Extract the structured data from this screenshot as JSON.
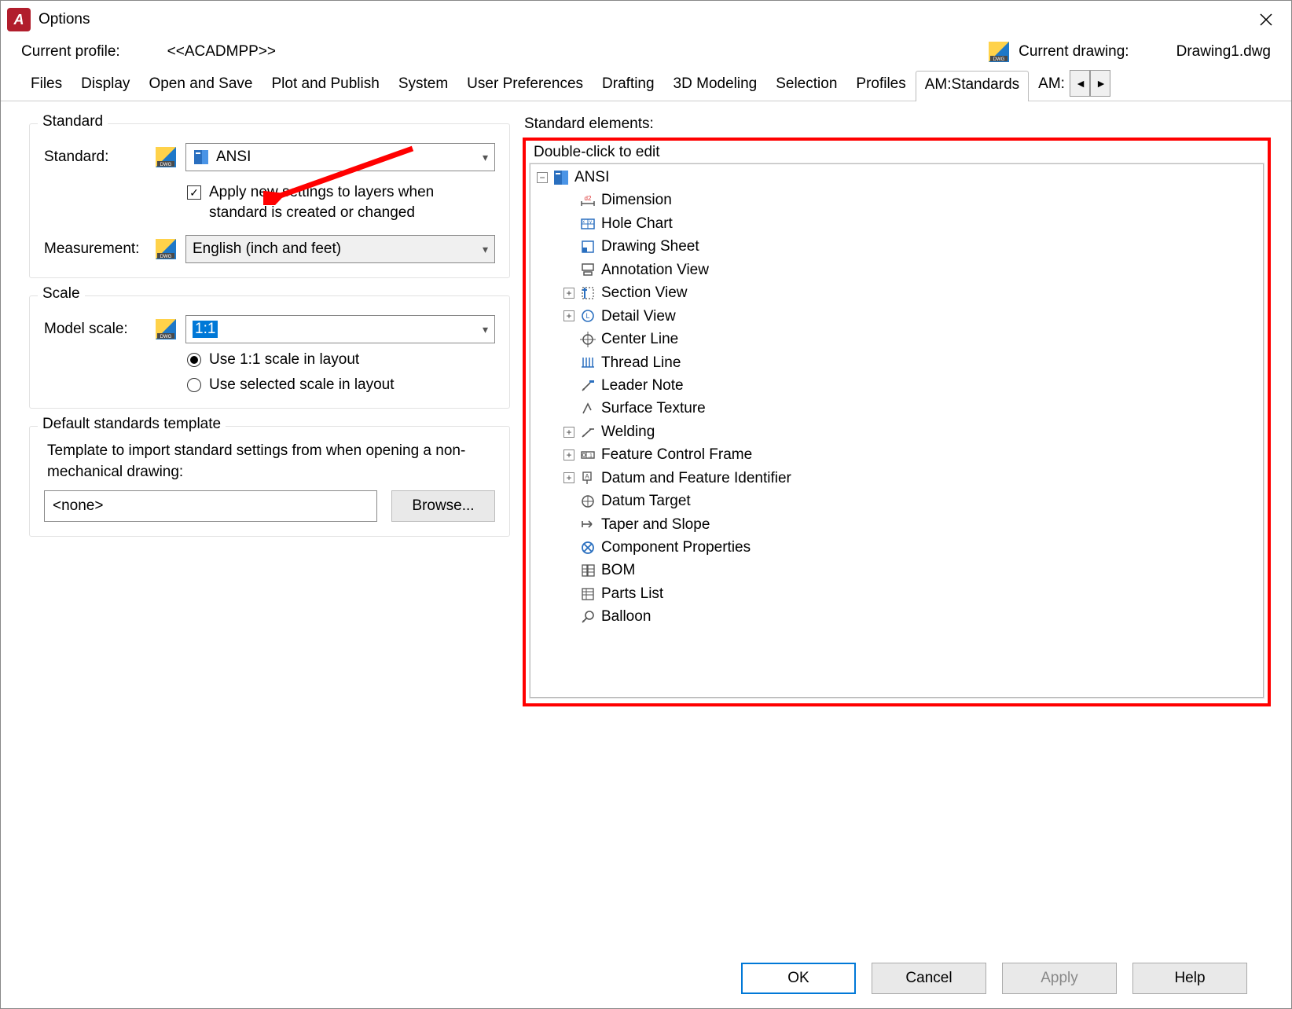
{
  "window": {
    "title": "Options"
  },
  "profile": {
    "label": "Current profile:",
    "value": "<<ACADMPP>>",
    "drawing_label": "Current drawing:",
    "drawing_value": "Drawing1.dwg"
  },
  "tabs": {
    "items": [
      "Files",
      "Display",
      "Open and Save",
      "Plot and Publish",
      "System",
      "User Preferences",
      "Drafting",
      "3D Modeling",
      "Selection",
      "Profiles",
      "AM:Standards",
      "AM:"
    ],
    "active_index": 10,
    "scroll_prev": "◄",
    "scroll_next": "►"
  },
  "standard_group": {
    "legend": "Standard",
    "standard_label": "Standard:",
    "standard_value": "ANSI",
    "apply_checkbox_checked": true,
    "apply_text": "Apply new settings to layers when standard is created or changed",
    "measurement_label": "Measurement:",
    "measurement_value": "English (inch and feet)"
  },
  "scale_group": {
    "legend": "Scale",
    "model_scale_label": "Model scale:",
    "model_scale_value": "1:1",
    "radio1": "Use 1:1 scale in layout",
    "radio2": "Use selected scale in layout",
    "selected_radio": 0
  },
  "template_group": {
    "legend": "Default standards template",
    "desc": "Template to import standard settings from when opening a non-mechanical drawing:",
    "value": "<none>",
    "browse": "Browse..."
  },
  "elements_panel": {
    "title": "Standard elements:",
    "hint": "Double-click to edit",
    "root": "ANSI",
    "items": [
      {
        "label": "Dimension",
        "icon": "dimension-icon"
      },
      {
        "label": "Hole Chart",
        "icon": "holechart-icon"
      },
      {
        "label": "Drawing Sheet",
        "icon": "drawingsheet-icon"
      },
      {
        "label": "Annotation View",
        "icon": "annotationview-icon"
      },
      {
        "label": "Section View",
        "icon": "sectionview-icon",
        "expandable": true
      },
      {
        "label": "Detail View",
        "icon": "detailview-icon",
        "expandable": true
      },
      {
        "label": "Center Line",
        "icon": "centerline-icon"
      },
      {
        "label": "Thread Line",
        "icon": "threadline-icon"
      },
      {
        "label": "Leader Note",
        "icon": "leadernote-icon"
      },
      {
        "label": "Surface Texture",
        "icon": "surfacetexture-icon"
      },
      {
        "label": "Welding",
        "icon": "welding-icon",
        "expandable": true
      },
      {
        "label": "Feature Control Frame",
        "icon": "fcf-icon",
        "expandable": true
      },
      {
        "label": "Datum and Feature Identifier",
        "icon": "datumid-icon",
        "expandable": true
      },
      {
        "label": "Datum Target",
        "icon": "datumtarget-icon"
      },
      {
        "label": "Taper and Slope",
        "icon": "taper-icon"
      },
      {
        "label": "Component Properties",
        "icon": "componentprops-icon"
      },
      {
        "label": "BOM",
        "icon": "bom-icon"
      },
      {
        "label": "Parts List",
        "icon": "partslist-icon"
      },
      {
        "label": "Balloon",
        "icon": "balloon-icon"
      }
    ]
  },
  "footer": {
    "ok": "OK",
    "cancel": "Cancel",
    "apply": "Apply",
    "help": "Help"
  },
  "icons": {
    "checkmark": "✓",
    "plus": "+",
    "minus": "−"
  },
  "colors": {
    "highlight_box": "#ff0000",
    "accent": "#0078d7",
    "app_red": "#b11d2c"
  }
}
